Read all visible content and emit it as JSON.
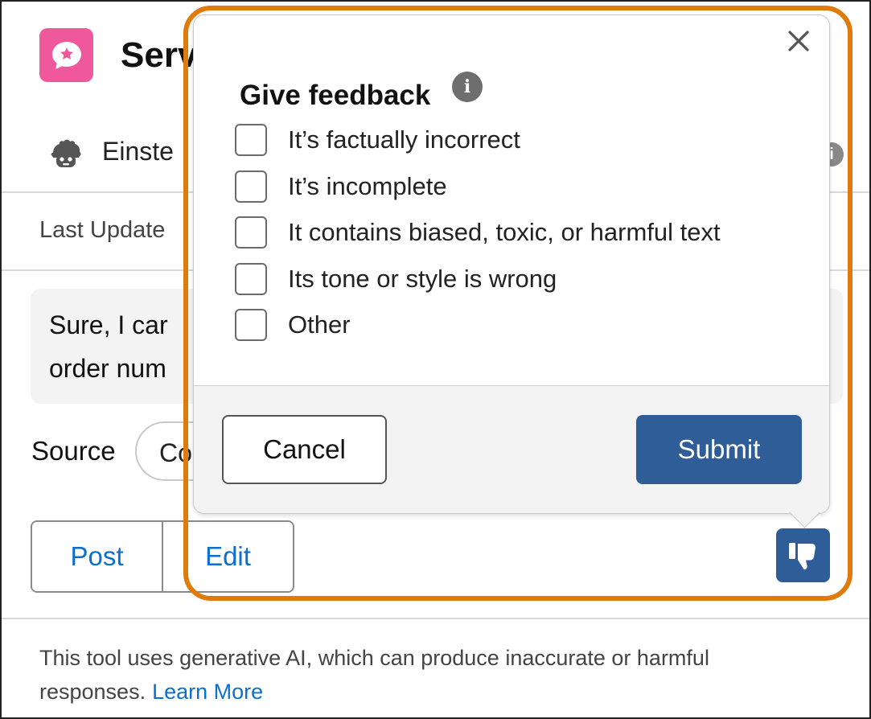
{
  "app": {
    "title": "Serv"
  },
  "einstein": {
    "label": "Einste"
  },
  "last_updated": "Last Update",
  "message": {
    "line1": "Sure, I car",
    "line2": "order num"
  },
  "source": {
    "label": "Source",
    "pill_text": "Co"
  },
  "actions": {
    "post_label": "Post",
    "edit_label": "Edit"
  },
  "footer": {
    "text": "This tool uses generative AI, which can produce inaccurate or harmful responses.",
    "link_label": "Learn More"
  },
  "feedback": {
    "title": "Give feedback",
    "info_glyph": "i",
    "options": [
      {
        "label": "It’s factually incorrect",
        "checked": false
      },
      {
        "label": "It’s incomplete",
        "checked": false
      },
      {
        "label": "It contains biased, toxic, or harmful text",
        "checked": false
      },
      {
        "label": "Its tone or style is wrong",
        "checked": false
      },
      {
        "label": "Other",
        "checked": false
      }
    ],
    "cancel_label": "Cancel",
    "submit_label": "Submit"
  },
  "icons": {
    "app": "chat-star-icon",
    "einstein": "einstein-avatar-icon",
    "info": "info-icon",
    "close": "close-icon",
    "thumbs_down": "thumbs-down-icon"
  },
  "colors": {
    "app_icon": "#f0589c",
    "highlight": "#e07b0b",
    "primary": "#2f5d98",
    "link": "#0b6fcf"
  }
}
